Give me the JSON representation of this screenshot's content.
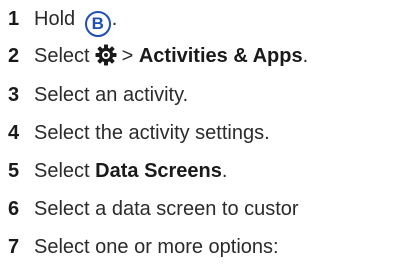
{
  "steps": [
    {
      "number": "1",
      "text": "Hold",
      "icon": "b-button-icon",
      "suffix": "."
    },
    {
      "number": "2",
      "prefix": "Select",
      "icon": "gear-icon",
      "middle": ">",
      "bold": "Activities & Apps",
      "suffix": "."
    },
    {
      "number": "3",
      "text": "Select an activity."
    },
    {
      "number": "4",
      "text": "Select the activity settings."
    },
    {
      "number": "5",
      "prefix": "Select",
      "bold": "Data Screens",
      "suffix": "."
    },
    {
      "number": "6",
      "text": "Select a data screen to custor"
    },
    {
      "number": "7",
      "text": "Select one or more options:"
    }
  ],
  "icons": {
    "b_button_label": "B",
    "accent_color": "#1f4fb3"
  }
}
